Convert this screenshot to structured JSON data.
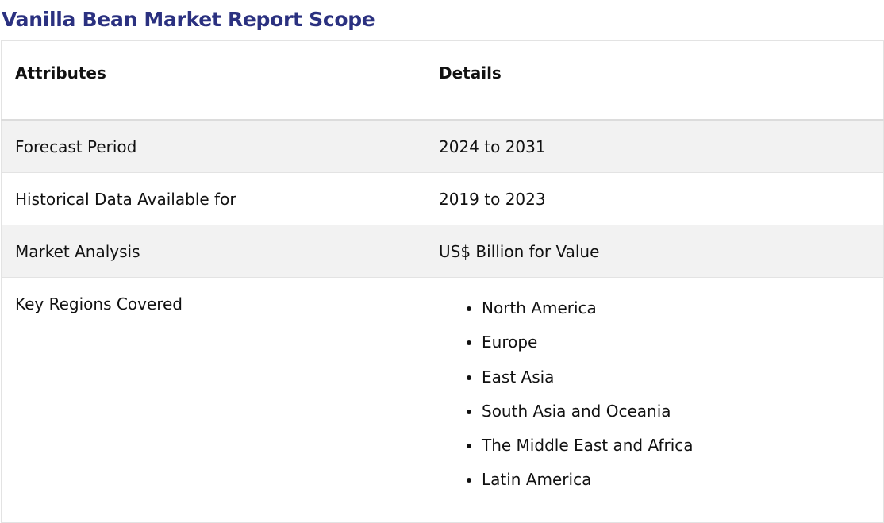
{
  "title": "Vanilla Bean Market Report Scope",
  "table": {
    "headers": [
      "Attributes",
      "Details"
    ],
    "rows": [
      {
        "attribute": "Forecast Period",
        "detail": "2024 to 2031"
      },
      {
        "attribute": "Historical Data Available for",
        "detail": "2019 to 2023"
      },
      {
        "attribute": "Market Analysis",
        "detail": "US$ Billion for Value"
      }
    ],
    "regions": {
      "attribute": "Key Regions Covered",
      "items": [
        "North America",
        "Europe",
        "East Asia",
        "South Asia and Oceania",
        "The Middle East and Africa",
        "Latin America"
      ]
    }
  },
  "colors": {
    "title": "#2b3180",
    "shaded_row": "#f2f2f2",
    "border": "#e3e3e3"
  }
}
